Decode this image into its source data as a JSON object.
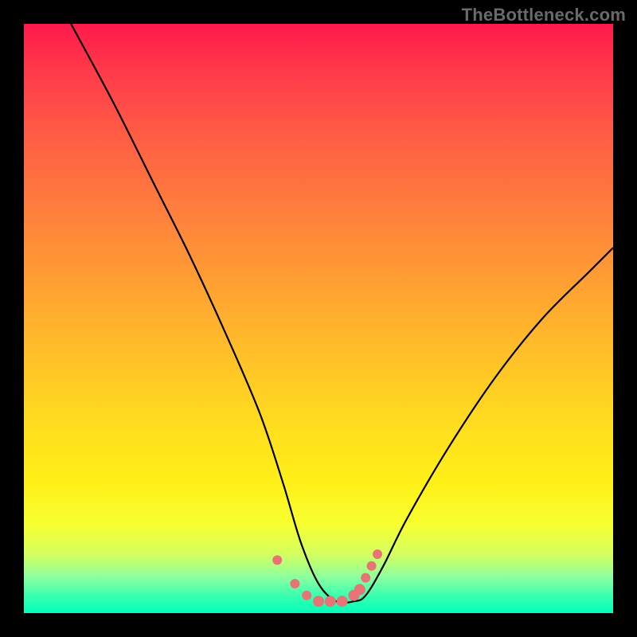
{
  "watermark": "TheBottleneck.com",
  "chart_data": {
    "type": "line",
    "title": "",
    "xlabel": "",
    "ylabel": "",
    "xlim": [
      0,
      100
    ],
    "ylim": [
      0,
      100
    ],
    "series": [
      {
        "name": "curve",
        "x": [
          8,
          15,
          22,
          28,
          34,
          40,
          44,
          47,
          50,
          53,
          56,
          58,
          61,
          65,
          72,
          80,
          88,
          96,
          100
        ],
        "values": [
          100,
          87,
          73,
          61,
          48,
          34,
          22,
          12,
          5,
          2,
          2,
          3,
          8,
          16,
          28,
          40,
          50,
          58,
          62
        ]
      },
      {
        "name": "markers",
        "x": [
          43,
          46,
          48,
          50,
          52,
          54,
          56,
          57,
          58,
          59,
          60
        ],
        "values": [
          9,
          5,
          3,
          2,
          2,
          2,
          3,
          4,
          6,
          8,
          10
        ]
      }
    ],
    "marker_color": "#e77474",
    "background_gradient": [
      "#ff1a4c",
      "#ffba2a",
      "#fff018",
      "#00ffb8"
    ]
  }
}
